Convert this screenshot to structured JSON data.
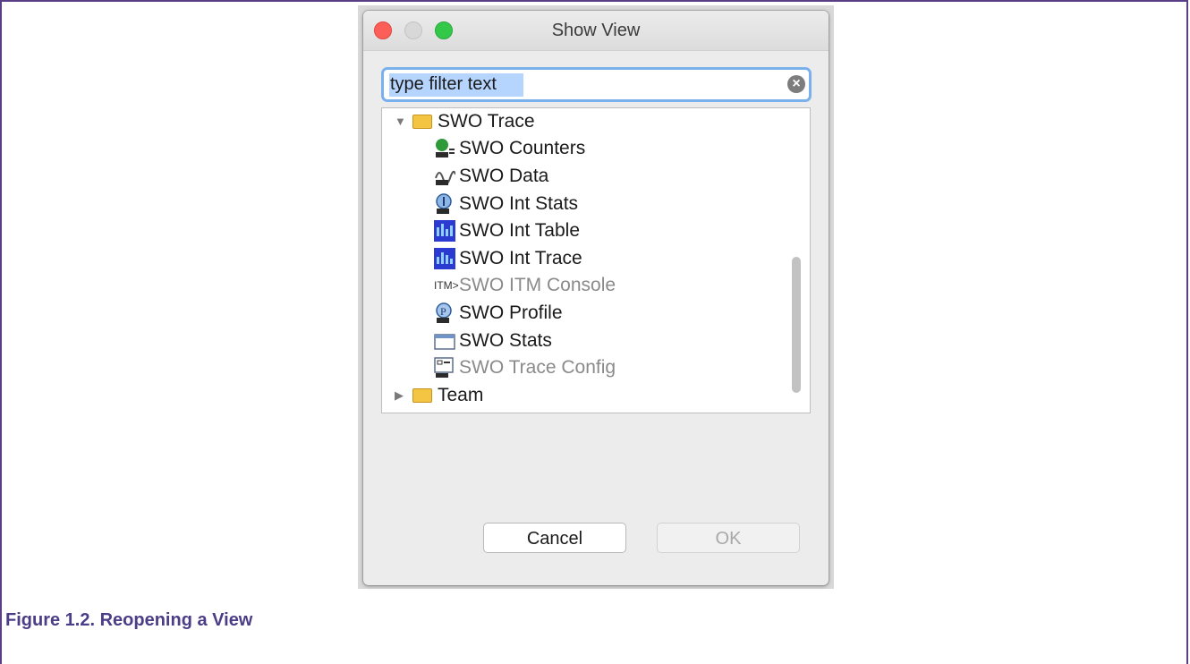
{
  "window": {
    "title": "Show View"
  },
  "filter": {
    "value": "type filter text"
  },
  "tree": {
    "group1": {
      "label": "SWO Trace",
      "expanded": true
    },
    "items": [
      {
        "label": "SWO Counters",
        "icon": "swo-counters-icon",
        "enabled": true
      },
      {
        "label": "SWO Data",
        "icon": "swo-data-icon",
        "enabled": true
      },
      {
        "label": "SWO Int Stats",
        "icon": "swo-int-stats-icon",
        "enabled": true
      },
      {
        "label": "SWO Int Table",
        "icon": "swo-int-table-icon",
        "enabled": true
      },
      {
        "label": "SWO Int Trace",
        "icon": "swo-int-trace-icon",
        "enabled": true
      },
      {
        "label": "SWO ITM Console",
        "icon": "itm-icon",
        "enabled": false
      },
      {
        "label": "SWO Profile",
        "icon": "swo-profile-icon",
        "enabled": true
      },
      {
        "label": "SWO Stats",
        "icon": "window-icon",
        "enabled": true
      },
      {
        "label": "SWO Trace Config",
        "icon": "swo-config-icon",
        "enabled": false
      }
    ],
    "group2": {
      "label": "Team",
      "expanded": false
    }
  },
  "buttons": {
    "cancel": "Cancel",
    "ok": "OK"
  },
  "caption": "Figure 1.2. Reopening a View",
  "colors": {
    "accent": "#7ab1ec",
    "caption": "#4b3d86",
    "frame": "#5a3e86"
  }
}
